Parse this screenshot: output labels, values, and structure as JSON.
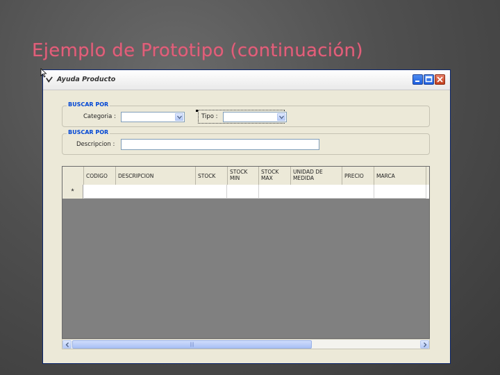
{
  "slide": {
    "title": "Ejemplo de Prototipo (continuación)"
  },
  "window": {
    "title": "Ayuda Producto",
    "controls": [
      "minimize",
      "maximize",
      "close"
    ]
  },
  "search_category": {
    "group_title": "BUSCAR POR",
    "category_label": "Categoria :",
    "category_value": "",
    "type_label": "Tipo :",
    "type_value": ""
  },
  "search_description": {
    "group_title": "BUSCAR POR",
    "description_label": "Descripcion :",
    "description_value": ""
  },
  "grid": {
    "columns": [
      {
        "label": "CODIGO"
      },
      {
        "label": "DESCRIPCION"
      },
      {
        "label": "STOCK"
      },
      {
        "label": "STOCK MIN"
      },
      {
        "label": "STOCK MAX"
      },
      {
        "label": "UNIDAD DE MEDIDA"
      },
      {
        "label": "PRECIO"
      },
      {
        "label": "MARCA"
      }
    ],
    "new_row_marker": "*"
  },
  "colors": {
    "title_accent": "#e0607a",
    "group_title": "#0046d5",
    "window_bg": "#ece9d8",
    "grid_bg": "#808080"
  }
}
